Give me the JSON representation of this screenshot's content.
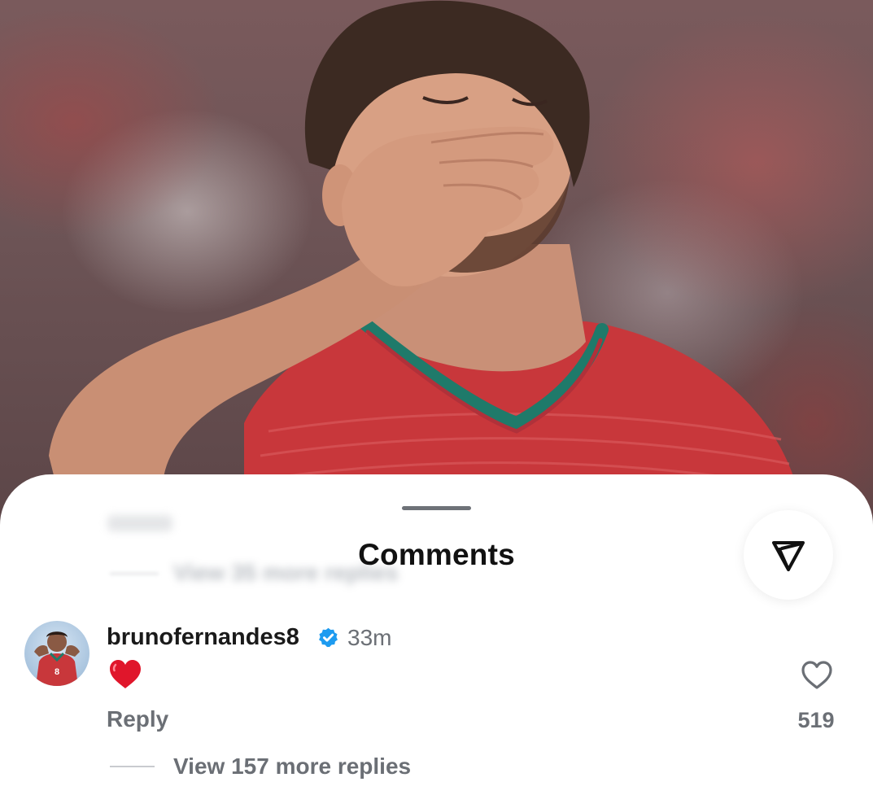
{
  "background_post": {
    "blurred_replies_link": "View 35 more replies"
  },
  "comments_sheet": {
    "title": "Comments",
    "share_icon": "paper-plane-icon"
  },
  "comment": {
    "username": "brunofernandes8",
    "verified": true,
    "timestamp": "33m",
    "text_emoji": "red-heart",
    "reply_label": "Reply",
    "like_icon": "heart-outline-icon",
    "like_count": "519",
    "view_replies_label": "View 157 more replies"
  },
  "colors": {
    "verified_blue": "#1d9bf0",
    "heart_red": "#e0162b",
    "secondary_text": "#6b6f75",
    "jersey_red": "#c8373b",
    "jersey_collar_green": "#1f7a6a"
  }
}
